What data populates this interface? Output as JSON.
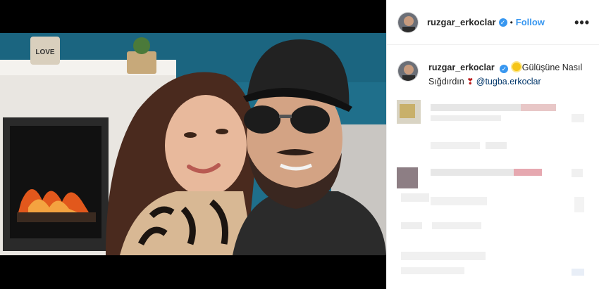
{
  "post": {
    "username": "ruzgar_erkoclar",
    "follow_label": "Follow",
    "separator": "•",
    "more_label": "•••",
    "verified_mark": "✓"
  },
  "caption": {
    "username": "ruzgar_erkoclar",
    "text_part1": "Gülüşüne Nasıl Sığdırdın",
    "mention": "@tugba.erkoclar",
    "emoji_sun": "sun-emoji",
    "emoji_rose": "rose-emoji"
  },
  "photo": {
    "sign_text": "LOVE"
  },
  "colors": {
    "accent": "#3897f0",
    "wall": "#1f6f8b",
    "mention": "#003569"
  }
}
